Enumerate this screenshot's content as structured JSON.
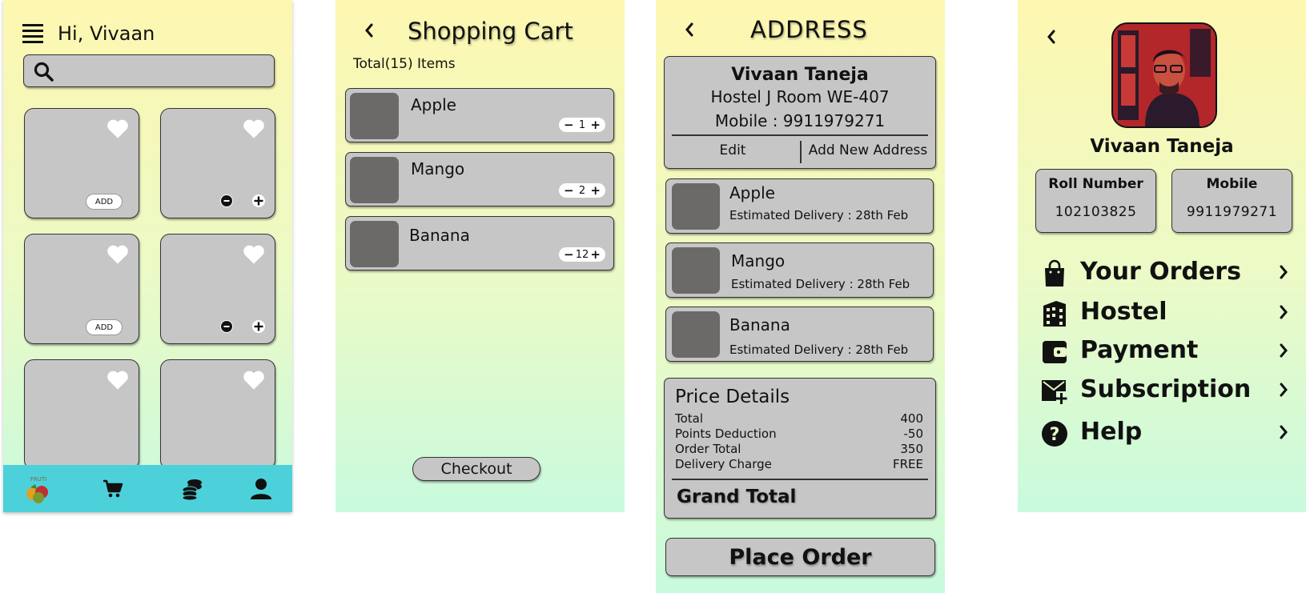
{
  "home": {
    "greeting": "Hi, Vivaan",
    "search_placeholder": "",
    "cards": [
      {
        "control": "add",
        "add_label": "ADD"
      },
      {
        "control": "stepper"
      },
      {
        "control": "add",
        "add_label": "ADD"
      },
      {
        "control": "stepper"
      },
      {
        "control": "none"
      },
      {
        "control": "none"
      }
    ],
    "nav": [
      "logo",
      "cart-icon",
      "coins-icon",
      "user-icon"
    ],
    "nav_color": "#4cd1db"
  },
  "cart": {
    "title": "Shopping Cart",
    "total_label": "Total(15) Items",
    "items": [
      {
        "name": "Apple",
        "qty": "1"
      },
      {
        "name": "Mango",
        "qty": "2"
      },
      {
        "name": "Banana",
        "qty": "12"
      }
    ],
    "checkout_label": "Checkout"
  },
  "address": {
    "title": "ADDRESS",
    "name": "Vivaan Taneja",
    "line1": "Hostel J Room WE-407",
    "mobile": "Mobile : 9911979271",
    "edit_label": "Edit",
    "add_new_label": "Add New Address",
    "items": [
      {
        "name": "Apple",
        "delivery": "Estimated Delivery : 28th Feb"
      },
      {
        "name": "Mango",
        "delivery": "Estimated Delivery : 28th Feb"
      },
      {
        "name": "Banana",
        "delivery": "Estimated Delivery : 28th Feb"
      }
    ],
    "price": {
      "title": "Price Details",
      "rows": [
        {
          "label": "Total",
          "value": "400"
        },
        {
          "label": "Points Deduction",
          "value": "-50"
        },
        {
          "label": "Order Total",
          "value": "350"
        },
        {
          "label": "Delivery Charge",
          "value": "FREE"
        }
      ],
      "grand_total_label": "Grand Total"
    },
    "place_order_label": "Place Order"
  },
  "profile": {
    "name": "Vivaan Taneja",
    "roll_label": "Roll Number",
    "roll_value": "102103825",
    "mobile_label": "Mobile",
    "mobile_value": "9911979271",
    "menu": [
      {
        "label": "Your Orders",
        "icon": "shopping-bag-icon"
      },
      {
        "label": "Hostel",
        "icon": "building-icon"
      },
      {
        "label": "Payment",
        "icon": "wallet-icon"
      },
      {
        "label": "Subscription",
        "icon": "mail-plus-icon"
      },
      {
        "label": "Help",
        "icon": "help-icon"
      }
    ]
  }
}
